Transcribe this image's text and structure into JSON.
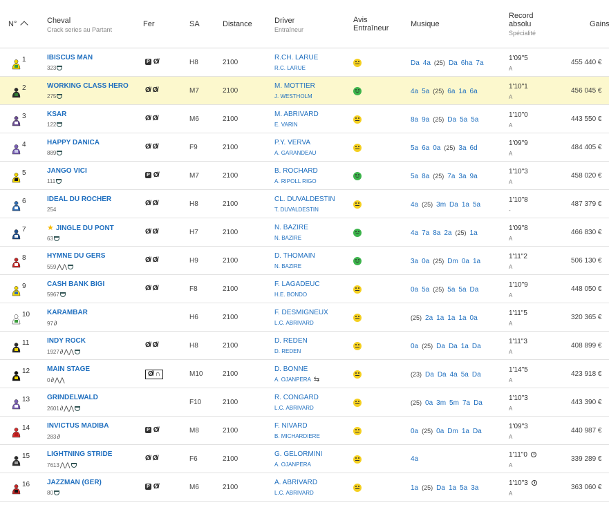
{
  "header": {
    "num": "N°",
    "cheval": "Cheval",
    "cheval_sub": "Crack series au Partant",
    "fer": "Fer",
    "sa": "SA",
    "distance": "Distance",
    "driver": "Driver",
    "driver_sub": "Entraîneur",
    "avis": "Avis Entraîneur",
    "musique": "Musique",
    "record": "Record absolu",
    "record_sub": "Spécialité",
    "gains": "Gains"
  },
  "colors": {
    "link": "#1f6fbf",
    "highlight_row": "#fcf8cd",
    "avis_yellow": "#f5d020",
    "avis_green": "#3cb44b"
  },
  "rows": [
    {
      "num": "1",
      "name": "IBISCUS MAN",
      "sub": "323",
      "icons": "cup",
      "fer": "P-shoe",
      "sa": "H8",
      "dist": "2100",
      "driver": "R.CH. LARUE",
      "trainer": "R.C. LARUE",
      "avis": "neutral",
      "musique": [
        "Da",
        "4a",
        "(25)",
        "Da",
        "6ha",
        "7a"
      ],
      "record": "1'09\"5",
      "rec_sub": "A",
      "gains": "455 440 €",
      "jc": [
        "#f2d600",
        "#3a9c3a"
      ]
    },
    {
      "num": "2",
      "name": "WORKING CLASS HERO",
      "sub": "275",
      "icons": "cup",
      "fer": "shoe-shoe",
      "sa": "M7",
      "dist": "2100",
      "driver": "M. MOTTIER",
      "trainer": "J. WESTHOLM",
      "avis": "happy",
      "musique": [
        "4a",
        "5a",
        "(25)",
        "6a",
        "1a",
        "6a"
      ],
      "record": "1'10\"1",
      "rec_sub": "A",
      "gains": "456 045 €",
      "jc": [
        "#2b2b2b",
        "#2e7d32"
      ]
    },
    {
      "num": "3",
      "name": "KSAR",
      "sub": "122",
      "icons": "cup",
      "fer": "shoe-shoe",
      "sa": "M6",
      "dist": "2100",
      "driver": "M. ABRIVARD",
      "trainer": "E. VARIN",
      "avis": "neutral",
      "musique": [
        "8a",
        "9a",
        "(25)",
        "Da",
        "5a",
        "5a"
      ],
      "record": "1'10\"0",
      "rec_sub": "A",
      "gains": "443 550 €",
      "jc": [
        "#6a4c93",
        "#ffffff"
      ]
    },
    {
      "num": "4",
      "name": "HAPPY DANICA",
      "sub": "889",
      "icons": "cup",
      "fer": "shoe-shoe",
      "sa": "F9",
      "dist": "2100",
      "driver": "P.Y. VERVA",
      "trainer": "A. GARANDEAU",
      "avis": "neutral",
      "musique": [
        "5a",
        "6a",
        "0a",
        "(25)",
        "3a",
        "6d"
      ],
      "record": "1'09\"9",
      "rec_sub": "A",
      "gains": "484 405 €",
      "jc": [
        "#7a5fb5",
        "#c9c9e8"
      ]
    },
    {
      "num": "5",
      "name": "JANGO VICI",
      "sub": "111",
      "icons": "cup",
      "fer": "P-shoe",
      "sa": "M7",
      "dist": "2100",
      "driver": "B. ROCHARD",
      "trainer": "A. RIPOLL RIGO",
      "avis": "happy",
      "musique": [
        "5a",
        "8a",
        "(25)",
        "7a",
        "3a",
        "9a"
      ],
      "record": "1'10\"3",
      "rec_sub": "A",
      "gains": "458 020 €",
      "jc": [
        "#f2d600",
        "#111111"
      ]
    },
    {
      "num": "6",
      "name": "IDEAL DU ROCHER",
      "sub": "254",
      "icons": "",
      "fer": "shoe-shoe",
      "sa": "H8",
      "dist": "2100",
      "driver": "CL. DUVALDESTIN",
      "trainer": "T. DUVALDESTIN",
      "avis": "neutral",
      "musique": [
        "4a",
        "(25)",
        "3m",
        "Da",
        "1a",
        "5a"
      ],
      "record": "1'10\"8",
      "rec_sub": "-",
      "gains": "487 379 €",
      "jc": [
        "#2f6db5",
        "#ffffff"
      ]
    },
    {
      "num": "7",
      "name": "JINGLE DU PONT",
      "sub": "63",
      "icons": "cup",
      "fer": "shoe-shoe",
      "sa": "H7",
      "dist": "2100",
      "driver": "N. BAZIRE",
      "trainer": "N. BAZIRE",
      "avis": "happy",
      "musique": [
        "4a",
        "7a",
        "8a",
        "2a",
        "(25)",
        "1a"
      ],
      "record": "1'09\"8",
      "rec_sub": "A",
      "gains": "466 830 €",
      "jc": [
        "#1f4e8c",
        "#f2f2f2"
      ],
      "star": true
    },
    {
      "num": "8",
      "name": "HYMNE DU GERS",
      "sub": "559",
      "icons": "shoe-cup",
      "fer": "shoe-shoe",
      "sa": "H9",
      "dist": "2100",
      "driver": "D. THOMAIN",
      "trainer": "N. BAZIRE",
      "avis": "happy",
      "musique": [
        "3a",
        "0a",
        "(25)",
        "Dm",
        "0a",
        "1a"
      ],
      "record": "1'11\"2",
      "rec_sub": "A",
      "gains": "506 130 €",
      "jc": [
        "#c62828",
        "#ffffff"
      ]
    },
    {
      "num": "9",
      "name": "CASH BANK BIGI",
      "sub": "5967",
      "icons": "cup",
      "fer": "shoe-shoe",
      "sa": "F8",
      "dist": "2100",
      "driver": "F. LAGADEUC",
      "trainer": "H.E. BONDO",
      "avis": "neutral",
      "musique": [
        "0a",
        "5a",
        "(25)",
        "5a",
        "5a",
        "Da"
      ],
      "record": "1'10\"9",
      "rec_sub": "A",
      "gains": "448 050 €",
      "jc": [
        "#f2d600",
        "#2f6db5"
      ]
    },
    {
      "num": "10",
      "name": "KARAMBAR",
      "sub": "97",
      "icons": "link",
      "fer": "",
      "sa": "H6",
      "dist": "2100",
      "driver": "F. DESMIGNEUX",
      "trainer": "L.C. ABRIVARD",
      "avis": "neutral",
      "musique": [
        "(25)",
        "2a",
        "1a",
        "1a",
        "1a",
        "0a"
      ],
      "record": "1'11\"5",
      "rec_sub": "A",
      "gains": "320 365 €",
      "jc": [
        "#ffffff",
        "#3a9c3a"
      ]
    },
    {
      "num": "11",
      "name": "INDY ROCK",
      "sub": "1927",
      "icons": "link-shoe-cup",
      "fer": "shoe-shoe",
      "sa": "H8",
      "dist": "2100",
      "driver": "D. REDEN",
      "trainer": "D. REDEN",
      "avis": "neutral",
      "musique": [
        "0a",
        "(25)",
        "Da",
        "Da",
        "1a",
        "Da"
      ],
      "record": "1'11\"3",
      "rec_sub": "A",
      "gains": "408 899 €",
      "jc": [
        "#2b2b2b",
        "#f2d600"
      ]
    },
    {
      "num": "12",
      "name": "MAIN STAGE",
      "sub": "0",
      "icons": "link-shoe",
      "fer": "boxed",
      "sa": "M10",
      "dist": "2100",
      "driver": "D. BONNE",
      "trainer": "A. OJANPERA",
      "avis": "neutral",
      "musique": [
        "(23)",
        "Da",
        "Da",
        "4a",
        "5a",
        "Da"
      ],
      "record": "1'14\"5",
      "rec_sub": "A",
      "gains": "423 918 €",
      "jc": [
        "#111111",
        "#f2d600"
      ],
      "swap": true
    },
    {
      "num": "13",
      "name": "GRINDELWALD",
      "sub": "2601",
      "icons": "link-shoe-cup",
      "fer": "",
      "sa": "F10",
      "dist": "2100",
      "driver": "R. CONGARD",
      "trainer": "L.C. ABRIVARD",
      "avis": "neutral",
      "musique": [
        "(25)",
        "0a",
        "3m",
        "5m",
        "7a",
        "Da"
      ],
      "record": "1'10\"3",
      "rec_sub": "A",
      "gains": "443 390 €",
      "jc": [
        "#7a5fb5",
        "#ffffff"
      ]
    },
    {
      "num": "14",
      "name": "INVICTUS MADIBA",
      "sub": "283",
      "icons": "link",
      "fer": "P-shoe",
      "sa": "M8",
      "dist": "2100",
      "driver": "F. NIVARD",
      "trainer": "B. MICHARDIERE",
      "avis": "neutral",
      "musique": [
        "0a",
        "(25)",
        "0a",
        "Dm",
        "1a",
        "Da"
      ],
      "record": "1'09\"3",
      "rec_sub": "A",
      "gains": "440 987 €",
      "jc": [
        "#d32f2f",
        "#b71c1c"
      ]
    },
    {
      "num": "15",
      "name": "LIGHTNING STRIDE",
      "sub": "7613",
      "icons": "shoe-cup",
      "fer": "shoe-shoe",
      "sa": "F6",
      "dist": "2100",
      "driver": "G. GELORMINI",
      "trainer": "A. OJANPERA",
      "avis": "neutral",
      "musique": [
        "4a"
      ],
      "record": "1'11\"0",
      "rec_sub": "A",
      "gains": "339 289 €",
      "jc": [
        "#2b2b2b",
        "#9e9e9e"
      ],
      "clock": true
    },
    {
      "num": "16",
      "name": "JAZZMAN (GER)",
      "sub": "80",
      "icons": "cup",
      "fer": "P-shoe",
      "sa": "M6",
      "dist": "2100",
      "driver": "A. ABRIVARD",
      "trainer": "L.C. ABRIVARD",
      "avis": "neutral",
      "musique": [
        "1a",
        "(25)",
        "Da",
        "1a",
        "5a",
        "3a"
      ],
      "record": "1'10\"3",
      "rec_sub": "A",
      "gains": "363 060 €",
      "jc": [
        "#c62828",
        "#111111"
      ],
      "clock": true
    }
  ]
}
